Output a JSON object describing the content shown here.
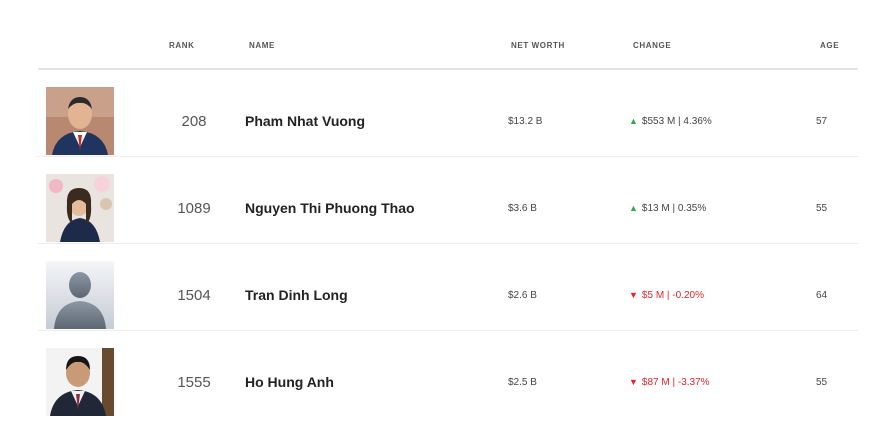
{
  "header": {
    "rank": "RANK",
    "name": "NAME",
    "net_worth": "NET WORTH",
    "change": "CHANGE",
    "age": "AGE"
  },
  "colors": {
    "up": "#33a94e",
    "down": "#e0262b"
  },
  "rows": [
    {
      "rank": "208",
      "name": "Pham Nhat Vuong",
      "net_worth": "$13.2 B",
      "direction": "up",
      "arrow": "▲",
      "change": "$553 M | 4.36%",
      "age": "57",
      "photo_icon": "portrait-man-suit"
    },
    {
      "rank": "1089",
      "name": "Nguyen Thi Phuong Thao",
      "net_worth": "$3.6 B",
      "direction": "up",
      "arrow": "▲",
      "change": "$13 M | 0.35%",
      "age": "55",
      "photo_icon": "portrait-woman"
    },
    {
      "rank": "1504",
      "name": "Tran Dinh Long",
      "net_worth": "$2.6 B",
      "direction": "down",
      "arrow": "▼",
      "change": "$5 M | -0.20%",
      "age": "64",
      "photo_icon": "placeholder-silhouette"
    },
    {
      "rank": "1555",
      "name": "Ho Hung Anh",
      "net_worth": "$2.5 B",
      "direction": "down",
      "arrow": "▼",
      "change": "$87 M | -3.37%",
      "age": "55",
      "photo_icon": "portrait-man-suit"
    }
  ]
}
